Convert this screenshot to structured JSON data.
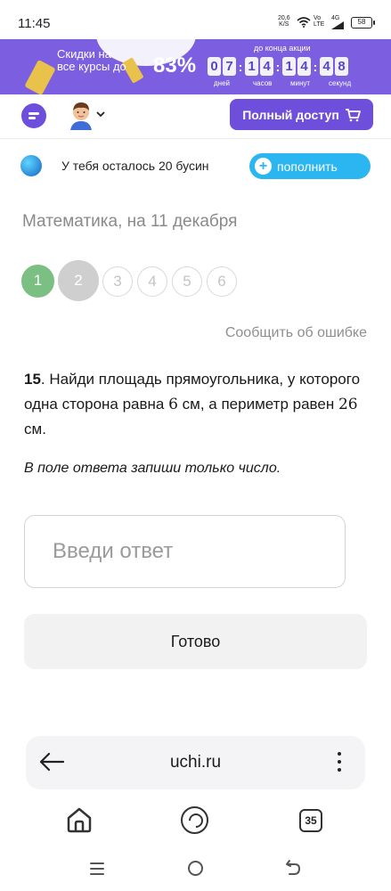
{
  "status_bar": {
    "time": "11:45",
    "net_speed_value": "20,6",
    "net_speed_unit": "K/S",
    "volte_top": "Vo",
    "volte_bottom": "LTE",
    "network": "4G",
    "battery": "58"
  },
  "promo": {
    "text": "Скидки на все курсы до",
    "percent": "83%",
    "until_label": "до конца акции",
    "timer": {
      "days": [
        "0",
        "7"
      ],
      "hours": [
        "1",
        "4"
      ],
      "minutes": [
        "1",
        "4"
      ],
      "seconds": [
        "4",
        "8"
      ],
      "days_label": "дней",
      "hours_label": "часов",
      "minutes_label": "минут",
      "seconds_label": "секунд"
    },
    "accent_color": "#7b5fe0"
  },
  "header": {
    "full_access_label": "Полный доступ",
    "brand_color": "#6e4fdc"
  },
  "beads": {
    "message": "У тебя осталось 20 бусин",
    "topup_label": "пополнить",
    "topup_color": "#2bb6f2"
  },
  "lesson": {
    "subject": "Математика, на 11 декабря",
    "steps": [
      "1",
      "2",
      "3",
      "4",
      "5",
      "6"
    ],
    "completed_steps": 1,
    "current_step": 2,
    "report_error": "Сообщить об ошибке"
  },
  "task": {
    "number": "15",
    "text_part1": ". Найди площадь прямоугольника, у которого одна сторона равна ",
    "side": "6",
    "text_part2": " см, а периметр равен ",
    "perimeter": "26",
    "text_part3": " см.",
    "hint": "В поле ответа запиши только число.",
    "answer_placeholder": "Введи ответ",
    "answer_value": "",
    "done_label": "Готово"
  },
  "browser": {
    "url": "uchi.ru",
    "tabs_count": "35"
  }
}
